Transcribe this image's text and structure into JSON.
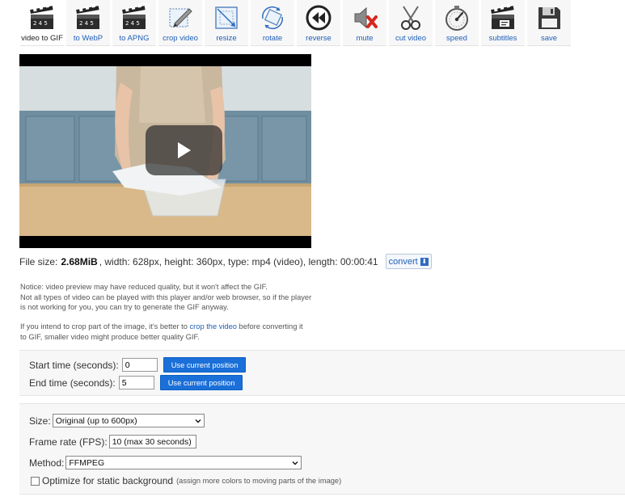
{
  "toolbar": {
    "tools": [
      {
        "label": "video to GIF",
        "icon": "clapperboard-icon",
        "active": true
      },
      {
        "label": "to WebP",
        "icon": "clapperboard-icon"
      },
      {
        "label": "to APNG",
        "icon": "clapperboard-icon"
      },
      {
        "label": "crop video",
        "icon": "crop-icon"
      },
      {
        "label": "resize",
        "icon": "resize-icon"
      },
      {
        "label": "rotate",
        "icon": "rotate-icon"
      },
      {
        "label": "reverse",
        "icon": "reverse-icon"
      },
      {
        "label": "mute",
        "icon": "mute-icon"
      },
      {
        "label": "cut video",
        "icon": "scissors-icon"
      },
      {
        "label": "speed",
        "icon": "speedometer-icon"
      },
      {
        "label": "subtitles",
        "icon": "subtitles-clapperboard-icon"
      },
      {
        "label": "save",
        "icon": "floppy-disk-icon"
      }
    ],
    "clapper_digits": "2 4 5"
  },
  "file_info": {
    "prefix": "File size:",
    "size": "2.68MiB",
    "details": ", width: 628px, height: 360px, type: mp4 (video), length: 00:00:41",
    "convert_label": "convert"
  },
  "notice": {
    "text1": "Notice: video preview may have reduced quality, but it won't affect the GIF.",
    "text2": "Not all types of video can be played with this player and/or web browser, so if the player",
    "text3": "is not working for you, you can try to generate the GIF anyway.",
    "crop_before": "If you intend to crop part of the image, it's better to ",
    "crop_link": "crop the video",
    "crop_after": " before converting it",
    "crop_line2": "to GIF, smaller video might produce better quality GIF."
  },
  "time": {
    "start_label": "Start time (seconds):",
    "start_value": "0",
    "end_label": "End time (seconds):",
    "end_value": "5",
    "button_label": "Use current position"
  },
  "options": {
    "size_label": "Size:",
    "size_value": "Original (up to 600px)",
    "fps_label": "Frame rate (FPS):",
    "fps_value": "10 (max 30 seconds)",
    "method_label": "Method:",
    "method_value": "FFMPEG",
    "optimize_label": "Optimize for static background",
    "optimize_note": "(assign more colors to moving parts of the image)"
  },
  "colors": {
    "link": "#2060b8",
    "button": "#1a6fd8",
    "panel": "#f7f7f7"
  }
}
